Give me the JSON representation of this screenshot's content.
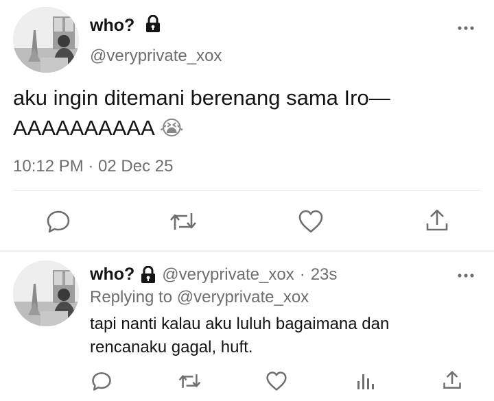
{
  "main_tweet": {
    "author_name": "who?",
    "author_handle": "@veryprivate_xox",
    "text_line1": "aku ingin ditemani berenang sama Iro—",
    "text_line2": "AAAAAAAAAA",
    "emoji": "😭",
    "timestamp": "10:12 PM · 02 Dec 25",
    "actions": [
      "reply-icon",
      "retweet-icon",
      "like-icon",
      "share-icon"
    ]
  },
  "reply_tweet": {
    "author_name": "who?",
    "author_handle": "@veryprivate_xox",
    "age_separator": "·",
    "age": "23s",
    "replying_label": "Replying to",
    "replying_handle": "@veryprivate_xox",
    "text_line1": "tapi nanti kalau aku luluh bagaimana dan",
    "text_line2": "rencanaku gagal, huft.",
    "actions": [
      "reply-icon",
      "retweet-icon",
      "like-icon",
      "analytics-icon",
      "share-icon"
    ]
  },
  "colors": {
    "text_primary": "#141414",
    "text_secondary": "#6e6e6e",
    "divider": "#e6e6e6",
    "gap": "#f0f0f0"
  }
}
